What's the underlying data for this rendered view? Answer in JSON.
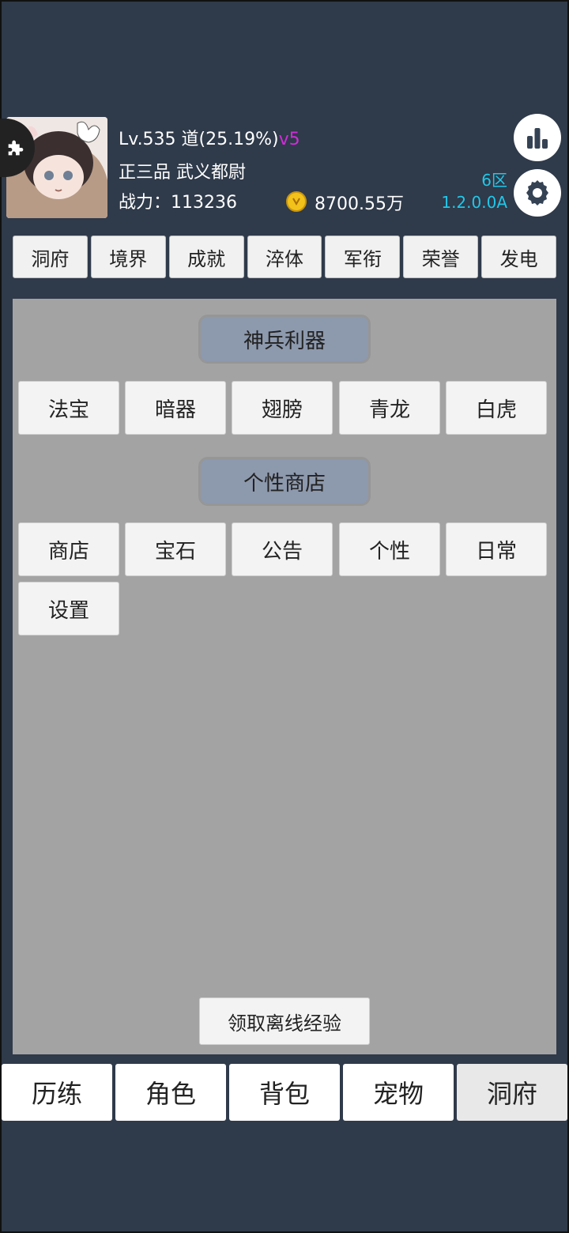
{
  "player": {
    "level_text": "Lv.535 道(25.19%)",
    "vip": "v5",
    "rank": "正三品 武义都尉",
    "power_text": "战力：113236",
    "gold": "8700.55万",
    "zone": "6区",
    "version": "1.2.0.0A"
  },
  "top_tabs": [
    "洞府",
    "境界",
    "成就",
    "淬体",
    "军衔",
    "荣誉",
    "发电"
  ],
  "sections": [
    {
      "title": "神兵利器",
      "items": [
        "法宝",
        "暗器",
        "翅膀",
        "青龙",
        "白虎"
      ]
    },
    {
      "title": "个性商店",
      "items": [
        "商店",
        "宝石",
        "公告",
        "个性",
        "日常",
        "设置"
      ]
    }
  ],
  "offline_button": "领取离线经验",
  "bottom_nav": [
    "历练",
    "角色",
    "背包",
    "宠物",
    "洞府"
  ],
  "active_bottom": "洞府",
  "colors": {
    "background": "#2f3a4a",
    "panel": "#a3a3a3",
    "section_title": "#8d99ad",
    "vip": "#d12bd8",
    "version": "#21c7e8"
  },
  "icons": {
    "avatar": "avatar-image",
    "badge": "puzzle-icon",
    "gold": "gold-coin-icon",
    "ranking": "bar-chart-icon",
    "settings": "gear-icon"
  }
}
